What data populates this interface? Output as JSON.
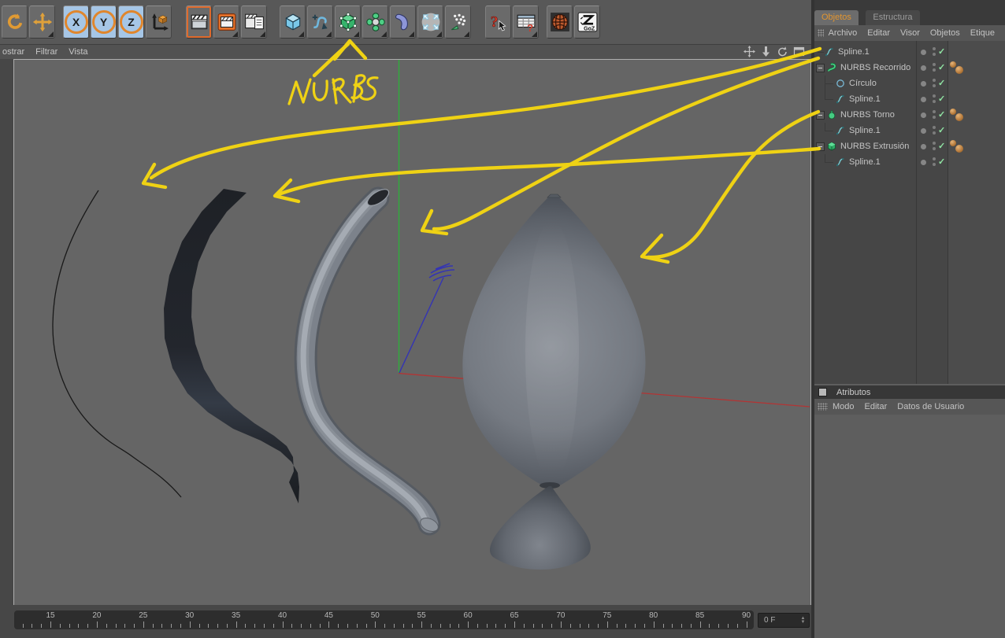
{
  "colors": {
    "annotation_yellow": "#efd214",
    "tab_active_text": "#e2952f",
    "check_green": "#8fe2a2",
    "tag_orange": "#b5793a",
    "axis_x_red": "#b33434",
    "axis_y_green": "#2fae3c",
    "axis_z_blue": "#3434b4",
    "viewport_bg": "#656565",
    "xyz_toggle_blue": "#a6c6e6",
    "render_active_orange": "#df6a2c"
  },
  "toolbar": {
    "buttons": [
      {
        "name": "undo-icon"
      },
      {
        "name": "move-icon",
        "sub": true
      },
      {
        "name": "x-axis-lock-icon",
        "letter": "X",
        "toggled": true
      },
      {
        "name": "y-axis-lock-icon",
        "letter": "Y",
        "toggled": true
      },
      {
        "name": "z-axis-lock-icon",
        "letter": "Z",
        "toggled": true
      },
      {
        "name": "coordinate-system-icon"
      },
      {
        "name": "render-view-icon",
        "active": true
      },
      {
        "name": "render-picture-viewer-icon",
        "sub": true
      },
      {
        "name": "render-settings-icon",
        "sub": true
      },
      {
        "name": "add-primitive-icon",
        "sub": true
      },
      {
        "name": "add-spline-icon",
        "sub": true
      },
      {
        "name": "add-nurbs-icon",
        "sub": true
      },
      {
        "name": "add-modeling-icon",
        "sub": true
      },
      {
        "name": "add-deformer-icon",
        "sub": true
      },
      {
        "name": "add-environment-icon",
        "sub": true
      },
      {
        "name": "add-particles-icon",
        "sub": true
      },
      {
        "name": "help-icon"
      },
      {
        "name": "content-browser-icon",
        "sub": true
      },
      {
        "name": "online-updater-icon"
      },
      {
        "name": "goz-icon",
        "label": "GoZ"
      }
    ]
  },
  "viewport_menu": {
    "items": [
      "ostrar",
      "Filtrar",
      "Vista"
    ],
    "controls": [
      "pan-icon",
      "dolly-icon",
      "rotate-view-icon",
      "maximize-view-icon"
    ]
  },
  "annotation": {
    "text": "NURBS"
  },
  "object_manager": {
    "tabs": [
      {
        "label": "Objetos",
        "active": true
      },
      {
        "label": "Estructura",
        "active": false
      }
    ],
    "menu": [
      "Archivo",
      "Editar",
      "Visor",
      "Objetos",
      "Etique"
    ],
    "tree": [
      {
        "label": "Spline.1",
        "icon": "spline-icon",
        "depth": 0,
        "expand": false,
        "tags": 0
      },
      {
        "label": "NURBS Recorrido",
        "icon": "sweep-nurbs-icon",
        "depth": 0,
        "expand": true,
        "tags": 2
      },
      {
        "label": "Círculo",
        "icon": "circle-spline-icon",
        "depth": 1,
        "tags": 0
      },
      {
        "label": "Spline.1",
        "icon": "spline-icon",
        "depth": 1,
        "tags": 0,
        "last": true
      },
      {
        "label": "NURBS Torno",
        "icon": "lathe-nurbs-icon",
        "depth": 0,
        "expand": true,
        "tags": 2
      },
      {
        "label": "Spline.1",
        "icon": "spline-icon",
        "depth": 1,
        "tags": 0,
        "last": true
      },
      {
        "label": "NURBS Extrusión",
        "icon": "extrude-nurbs-icon",
        "depth": 0,
        "expand": true,
        "tags": 2
      },
      {
        "label": "Spline.1",
        "icon": "spline-icon",
        "depth": 1,
        "tags": 0,
        "last": true
      }
    ]
  },
  "attributes_panel": {
    "title": "Atributos",
    "menu": [
      "Modo",
      "Editar",
      "Datos de Usuario"
    ]
  },
  "timeline": {
    "labels": [
      15,
      20,
      25,
      30,
      35,
      40,
      45,
      50,
      55,
      60,
      65,
      70,
      75,
      80,
      85,
      90
    ],
    "frame_field": "0 F"
  },
  "scene": {
    "objects": [
      "spline-object",
      "extrude-object",
      "sweep-object",
      "lathe-object",
      "world-axes"
    ]
  }
}
